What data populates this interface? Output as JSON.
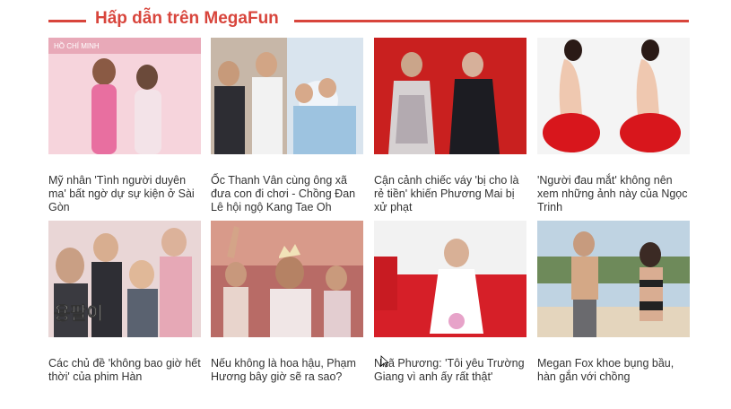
{
  "section": {
    "title": "Hấp dẫn trên MegaFun",
    "accent_color": "#d8453c"
  },
  "articles": [
    {
      "caption": "Mỹ nhân 'Tình người duyên ma' bất ngờ dự sự kiện ở Sài Gòn",
      "image_overlay": "HỒ CHÍ MINH"
    },
    {
      "caption": "Ốc Thanh Vân cùng ông xã đưa con đi chơi - Chồng Đan Lê hội ngộ Kang Tae Oh"
    },
    {
      "caption": "Cận cảnh chiếc váy 'bị cho là rẻ tiền' khiến Phương Mai bị xử phạt"
    },
    {
      "caption": "'Người đau mắt' không nên xem những ảnh này của Ngọc Trinh"
    },
    {
      "caption": "Các chủ đề 'không bao giờ hết thời' của phim Hàn",
      "image_overlay": "용팔이"
    },
    {
      "caption": "Nếu không là hoa hậu, Phạm Hương bây giờ sẽ ra sao?"
    },
    {
      "caption": "Nhã Phương: 'Tôi yêu Trường Giang vì anh ấy rất thật'"
    },
    {
      "caption": "Megan Fox khoe bụng bầu, hàn gắn với chồng"
    }
  ]
}
